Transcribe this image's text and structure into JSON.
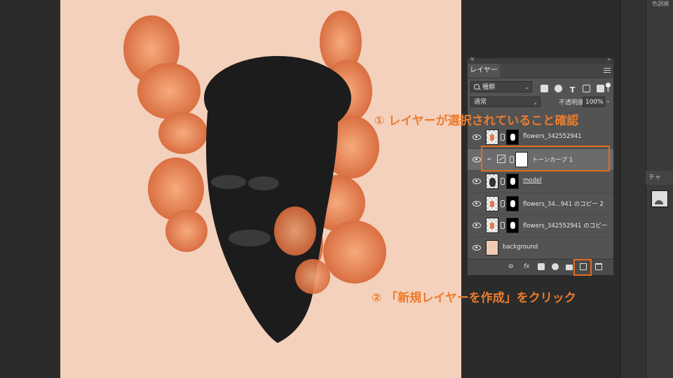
{
  "app": {
    "right_panel_tab": "チャ",
    "top_right_label": "色調補"
  },
  "layers_panel": {
    "tab_label": "レイヤー",
    "filter": {
      "value": "種類"
    },
    "blend_mode": "通常",
    "opacity_label": "不透明度：",
    "opacity_value": "100%",
    "layers": [
      {
        "name": "flowers_342552941",
        "type": "pixel+mask",
        "selected": false
      },
      {
        "name": "トーンカーブ 1",
        "type": "adjustment",
        "selected": true
      },
      {
        "name": "model",
        "type": "pixel+mask",
        "selected": false
      },
      {
        "name": "flowers_34...941 のコピー 2",
        "type": "pixel+mask",
        "selected": false
      },
      {
        "name": "flowers_342552941 のコピー",
        "type": "pixel+mask",
        "selected": false
      },
      {
        "name": "background",
        "type": "pixel",
        "selected": false
      }
    ],
    "footer_icons": [
      "link-icon",
      "fx-icon",
      "mask-icon",
      "adjustment-icon",
      "folder-icon",
      "new-layer-icon",
      "trash-icon"
    ],
    "fx_label": "fx"
  },
  "annotations": {
    "step1": "① レイヤーが選択されていること確認",
    "step2": "② 「新規レイヤーを作成」をクリック"
  },
  "colors": {
    "annotation": "#e36b20",
    "canvas_bg": "#f3d1bc",
    "panel_bg": "#535353"
  }
}
